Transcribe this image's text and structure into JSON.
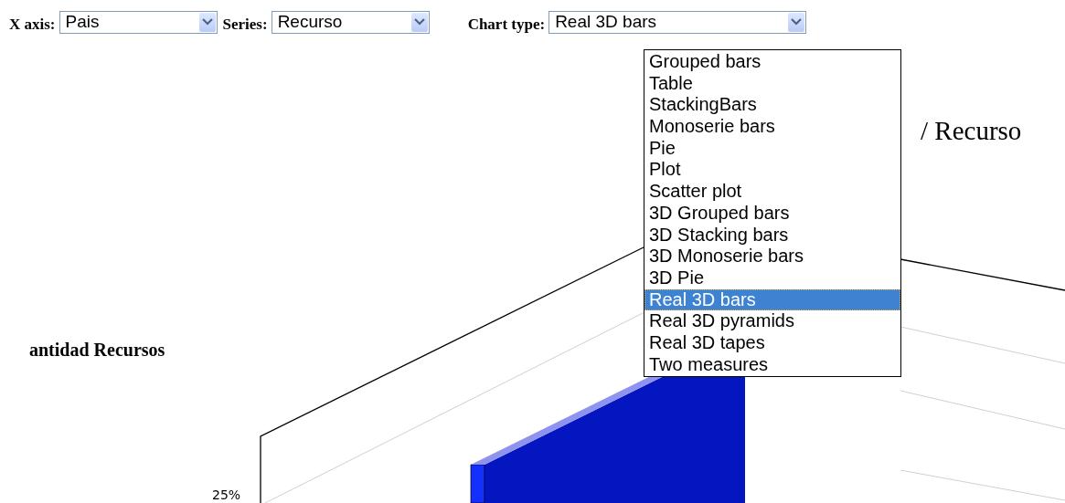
{
  "toolbar": [
    {
      "label": "X axis:",
      "value": "Pais",
      "open": false
    },
    {
      "label": "Series:",
      "value": "Recurso",
      "open": false
    },
    {
      "label": "Chart type:",
      "value": "Real 3D bars",
      "open": true,
      "options": [
        {
          "label": "Grouped bars",
          "selected": false
        },
        {
          "label": "Table",
          "selected": false
        },
        {
          "label": "StackingBars",
          "selected": false
        },
        {
          "label": "Monoserie bars",
          "selected": false
        },
        {
          "label": "Pie",
          "selected": false
        },
        {
          "label": "Plot",
          "selected": false
        },
        {
          "label": "Scatter plot",
          "selected": false
        },
        {
          "label": "3D Grouped bars",
          "selected": false
        },
        {
          "label": "3D Stacking bars",
          "selected": false
        },
        {
          "label": "3D Monoserie bars",
          "selected": false
        },
        {
          "label": "3D Pie",
          "selected": false
        },
        {
          "label": "Real 3D bars",
          "selected": true
        },
        {
          "label": "Real 3D pyramids",
          "selected": false
        },
        {
          "label": "Real 3D tapes",
          "selected": false
        },
        {
          "label": "Two measures",
          "selected": false
        }
      ]
    }
  ],
  "chart": {
    "title": "/ Recurso",
    "axis_label": "antidad Recursos",
    "tick": "25%"
  }
}
